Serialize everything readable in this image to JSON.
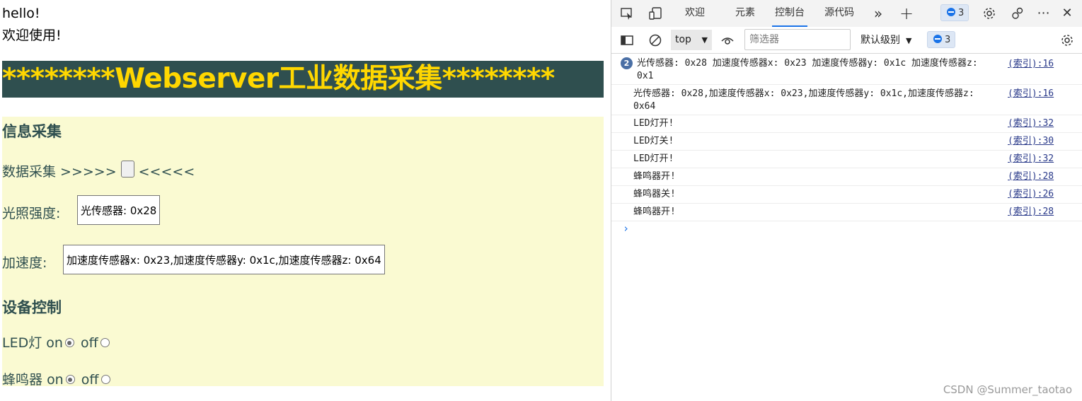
{
  "page": {
    "greeting_line1": "hello!",
    "greeting_line2": "欢迎使用!",
    "banner_title": "********Webserver工业数据采集********",
    "info_heading": "信息采集",
    "collect_prefix": "数据采集 >>>>>",
    "collect_suffix": "<<<<<",
    "light_label": "光照强度:",
    "light_value": "光传感器: 0x28",
    "accel_label": "加速度:",
    "accel_value": "加速度传感器x: 0x23,加速度传感器y: 0x1c,加速度传感器z: 0x64",
    "control_heading": "设备控制",
    "led_label": "LED灯",
    "buzzer_label": "蜂鸣器",
    "on_label": "on",
    "off_label": "off"
  },
  "devtools": {
    "tabs": [
      {
        "label": "欢迎"
      },
      {
        "label": "元素"
      },
      {
        "label": "控制台"
      },
      {
        "label": "源代码"
      }
    ],
    "issues_badge": "3",
    "context": "top",
    "filter_placeholder": "筛选器",
    "level": "默认级别",
    "messages_badge": "3",
    "console": [
      {
        "count": "2",
        "text": "光传感器: 0x28 加速度传感器x: 0x23 加速度传感器y: 0x1c 加速度传感器z: 0x1",
        "source": "(索引):16"
      },
      {
        "count": "",
        "text": "光传感器: 0x28,加速度传感器x: 0x23,加速度传感器y: 0x1c,加速度传感器z: 0x64",
        "source": "(索引):16"
      },
      {
        "count": "",
        "text": "LED灯开!",
        "source": "(索引):32"
      },
      {
        "count": "",
        "text": "LED灯关!",
        "source": "(索引):30"
      },
      {
        "count": "",
        "text": "LED灯开!",
        "source": "(索引):32"
      },
      {
        "count": "",
        "text": "蜂鸣器开!",
        "source": "(索引):28"
      },
      {
        "count": "",
        "text": "蜂鸣器关!",
        "source": "(索引):26"
      },
      {
        "count": "",
        "text": "蜂鸣器开!",
        "source": "(索引):28"
      }
    ],
    "prompt_symbol": "›"
  },
  "watermark": "CSDN @Summer_taotao",
  "colors": {
    "banner_bg": "#2f4f4f",
    "banner_text": "#ffd700",
    "panel_bg": "#fafad2",
    "panel_text": "#2f4f4f",
    "accent": "#1a73e8"
  }
}
